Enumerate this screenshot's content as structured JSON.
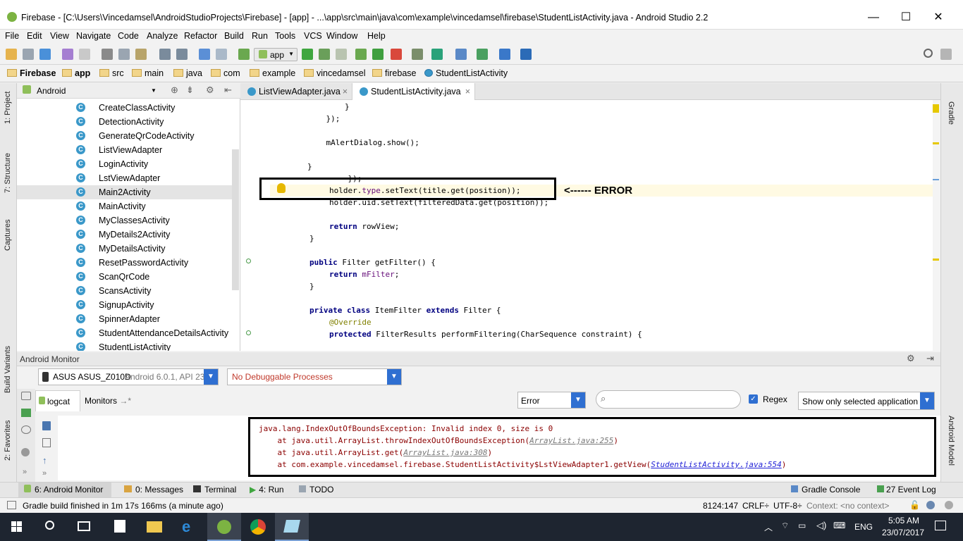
{
  "window": {
    "title": "Firebase - [C:\\Users\\Vincedamsel\\AndroidStudioProjects\\Firebase] - [app] - ...\\app\\src\\main\\java\\com\\example\\vincedamsel\\firebase\\StudentListActivity.java - Android Studio 2.2",
    "minimize": "—",
    "maximize": "☐",
    "close": "✕"
  },
  "menu": [
    "File",
    "Edit",
    "View",
    "Navigate",
    "Code",
    "Analyze",
    "Refactor",
    "Build",
    "Run",
    "Tools",
    "VCS",
    "Window",
    "Help"
  ],
  "toolbar": {
    "run_config": "app"
  },
  "breadcrumbs": [
    "Firebase",
    "app",
    "src",
    "main",
    "java",
    "com",
    "example",
    "vincedamsel",
    "firebase",
    "StudentListActivity"
  ],
  "left_strip": {
    "project": "1: Project",
    "structure": "7: Structure",
    "captures": "Captures",
    "build_variants": "Build Variants",
    "favorites": "2: Favorites"
  },
  "right_strip": {
    "gradle": "Gradle",
    "android_model": "Android Model"
  },
  "project_panel": {
    "view_mode": "Android",
    "items": [
      "CreateClassActivity",
      "DetectionActivity",
      "GenerateQrCodeActivity",
      "ListViewAdapter",
      "LoginActivity",
      "LstViewAdapter",
      "Main2Activity",
      "MainActivity",
      "MyClassesActivity",
      "MyDetails2Activity",
      "MyDetailsActivity",
      "ResetPasswordActivity",
      "ScanQrCode",
      "ScansActivity",
      "SignupActivity",
      "SpinnerAdapter",
      "StudentAttendanceDetailsActivity",
      "StudentListActivity"
    ],
    "selected": "Main2Activity"
  },
  "editor_tabs": [
    {
      "label": "ListViewAdapter.java",
      "active": false
    },
    {
      "label": "StudentListActivity.java",
      "active": true
    }
  ],
  "code": {
    "l1": "                }",
    "l2": "            });",
    "l3": "            mAlertDialog.show();",
    "l4": "        }",
    "l5": "    });",
    "l6_a": "holder.",
    "l6_b": "type",
    "l6_c": ".setText(title.get(position));",
    "l7": "holder.uid.setText(filteredData.get(position));",
    "l8_kw": "return",
    "l8": " rowView;",
    "l9": "}",
    "l10_kw": "public",
    "l10": " Filter getFilter() {",
    "l11_kw": "return",
    "l11_f": " mFilter",
    "l11": ";",
    "l12": "}",
    "l13_kw1": "private class",
    "l13": " ItemFilter ",
    "l13_kw2": "extends",
    "l13_b": " Filter {",
    "l14": "@Override",
    "l15_kw": "protected",
    "l15": " FilterResults performFiltering(CharSequence constraint) {"
  },
  "annotation": {
    "error_label": "<------ ERROR"
  },
  "android_monitor": {
    "title": "Android Monitor",
    "device": "ASUS ASUS_Z010D",
    "device_detail": "Android 6.0.1, API 23",
    "process": "No Debuggable Processes",
    "tab_logcat": "logcat",
    "tab_monitors": "Monitors",
    "log_level": "Error",
    "search_placeholder": "",
    "regex_label": "Regex",
    "filter": "Show only selected application",
    "log_lines": {
      "l1": "java.lang.IndexOutOfBoundsException: Invalid index 0, size is 0",
      "l2_a": "    at java.util.ArrayList.throwIndexOutOfBoundsException(",
      "l2_link": "ArrayList.java:255",
      "l2_b": ")",
      "l3_a": "    at java.util.ArrayList.get(",
      "l3_link": "ArrayList.java:308",
      "l3_b": ")",
      "l4_a": "    at com.example.vincedamsel.firebase.StudentListActivity$LstViewAdapter1.getView(",
      "l4_link": "StudentListActivity.java:554",
      "l4_b": ")"
    }
  },
  "bottom_tabs": {
    "android_monitor": "6: Android Monitor",
    "messages": "0: Messages",
    "terminal": "Terminal",
    "run": "4: Run",
    "todo": "TODO",
    "gradle_console": "Gradle Console",
    "event_log": "27  Event Log"
  },
  "status": {
    "message": "Gradle build finished in 1m 17s 166ms (a minute ago)",
    "position": "8124:147",
    "line_sep": "CRLF÷",
    "encoding": "UTF-8÷",
    "context": "Context: <no context>"
  },
  "taskbar": {
    "language": "ENG",
    "time": "5:05 AM",
    "date": "23/07/2017"
  },
  "colors": {
    "accent_blue": "#2f6fd1",
    "taskbar": "#1e2530",
    "error_text": "#8b0000"
  }
}
